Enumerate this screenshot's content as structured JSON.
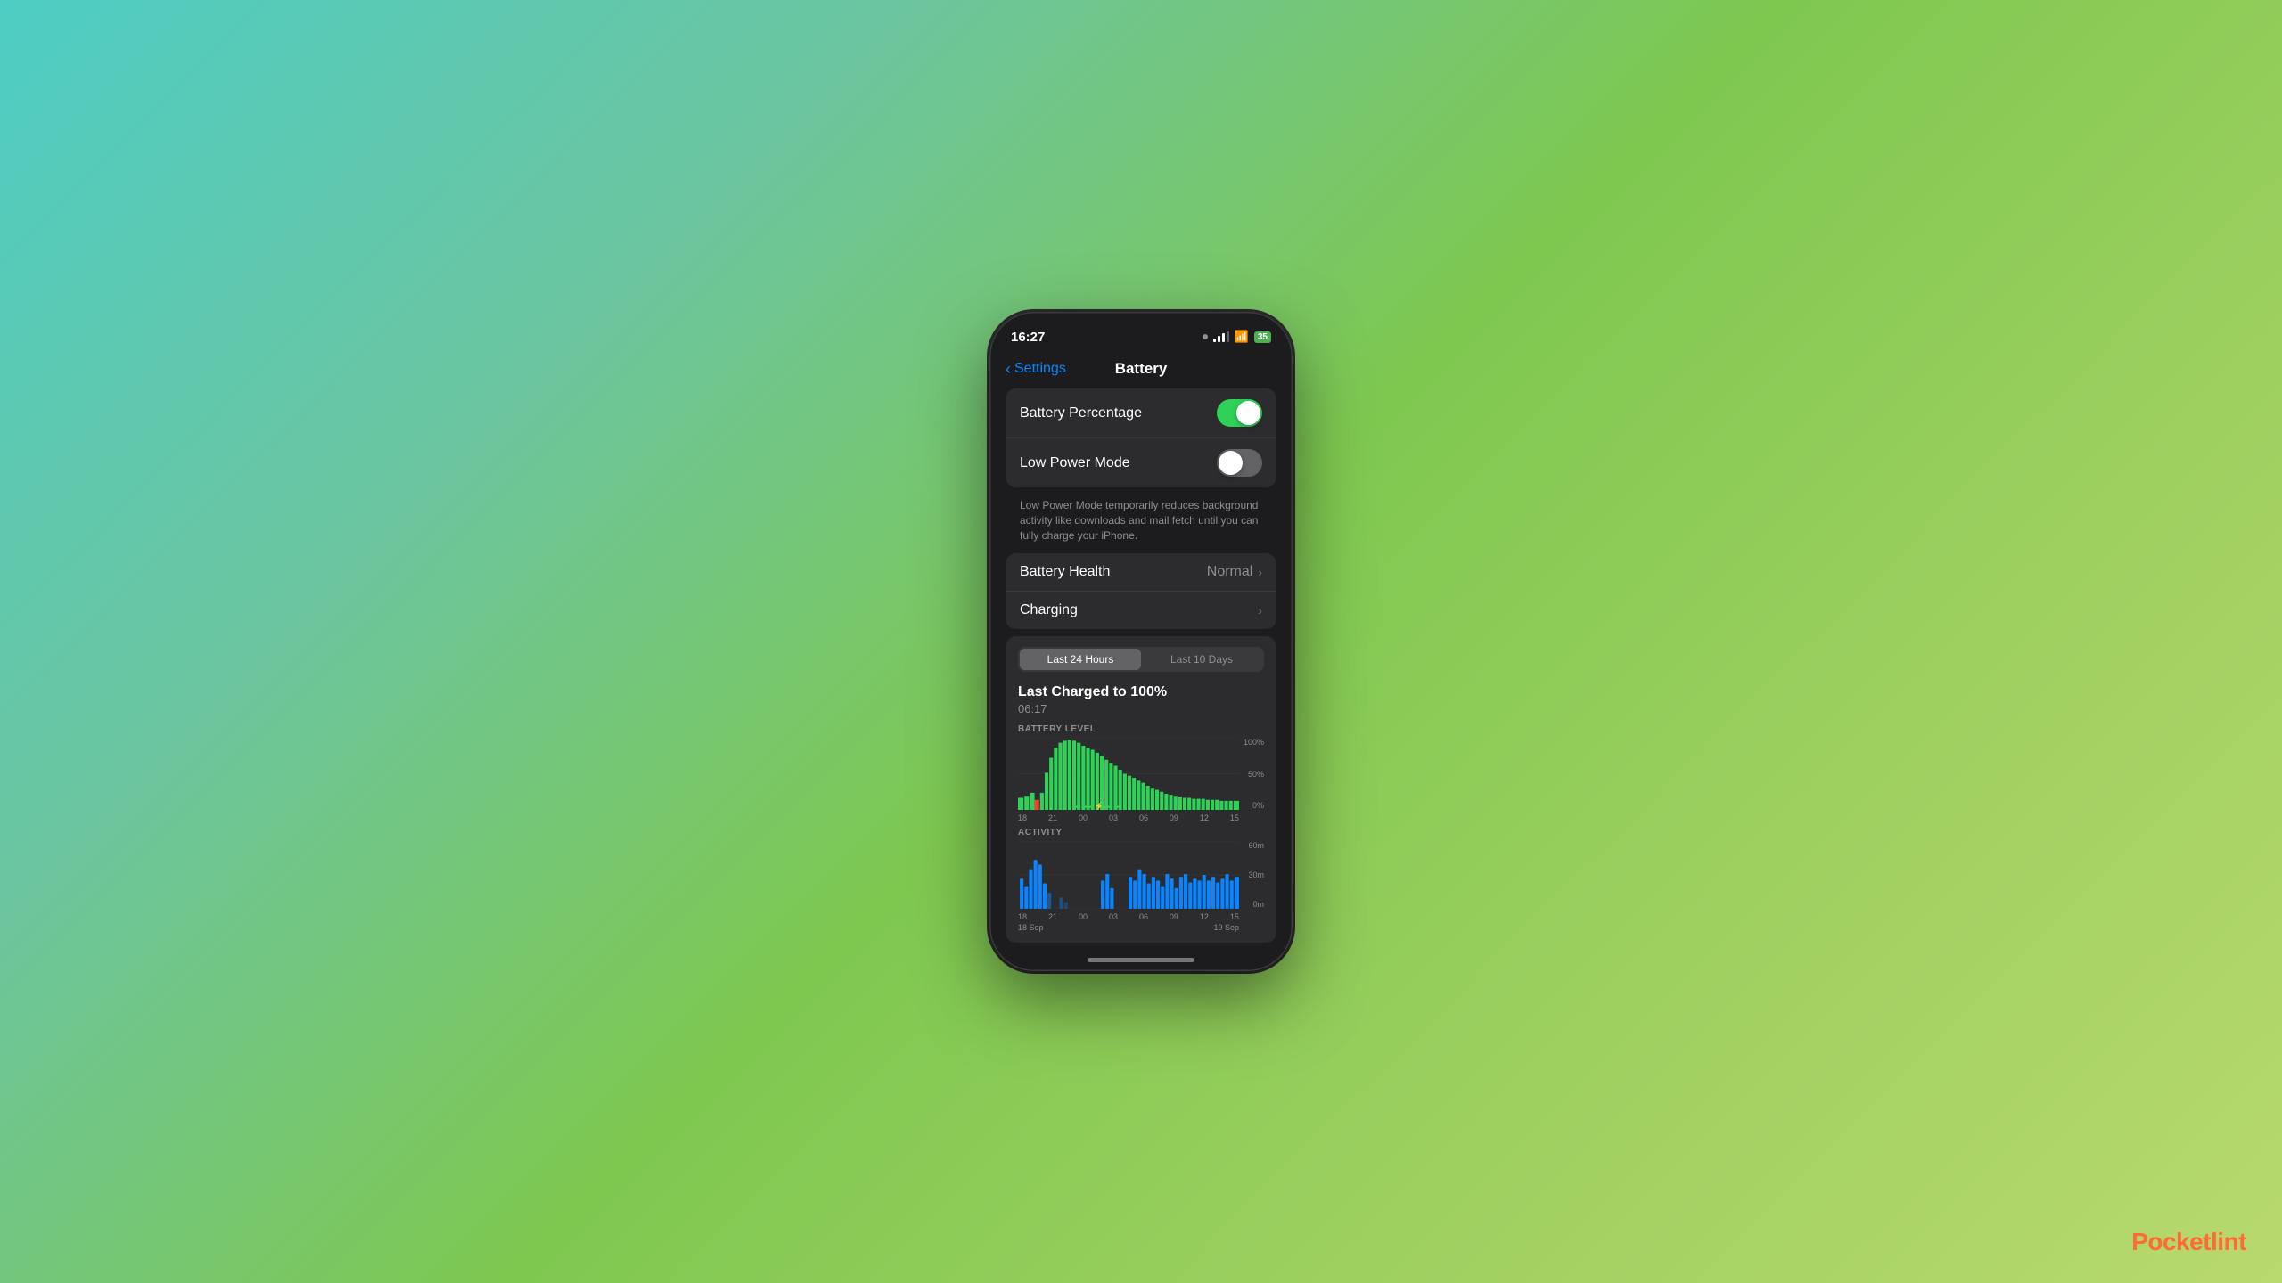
{
  "background": {
    "gradient": "teal-to-green"
  },
  "phone": {
    "status_bar": {
      "time": "16:27",
      "battery_level": "35"
    },
    "nav": {
      "back_label": "Settings",
      "title": "Battery"
    },
    "settings": {
      "group1": {
        "battery_percentage": {
          "label": "Battery Percentage",
          "toggle": "on"
        },
        "low_power_mode": {
          "label": "Low Power Mode",
          "toggle": "off"
        }
      },
      "description": "Low Power Mode temporarily reduces background activity like downloads and mail fetch until you can fully charge your iPhone.",
      "group2": {
        "battery_health": {
          "label": "Battery Health",
          "value": "Normal"
        },
        "charging": {
          "label": "Charging"
        }
      }
    },
    "chart": {
      "segment_active": "Last 24 Hours",
      "segment_inactive": "Last 10 Days",
      "last_charged_title": "Last Charged to 100%",
      "last_charged_time": "06:17",
      "battery_level_label": "BATTERY LEVEL",
      "battery_y_labels": [
        "100%",
        "50%",
        "0%"
      ],
      "battery_x_labels": [
        "18",
        "21",
        "00",
        "03",
        "06",
        "09",
        "12",
        "15"
      ],
      "activity_label": "ACTIVITY",
      "activity_y_labels": [
        "60m",
        "30m",
        "0m"
      ],
      "date_labels_left": [
        "18",
        "21",
        "00",
        "03",
        "06",
        "09",
        "12",
        "15"
      ],
      "date_row": [
        "18 Sep",
        "",
        "19 Sep"
      ]
    }
  },
  "pocketlint": {
    "text": "Pocketlint"
  }
}
